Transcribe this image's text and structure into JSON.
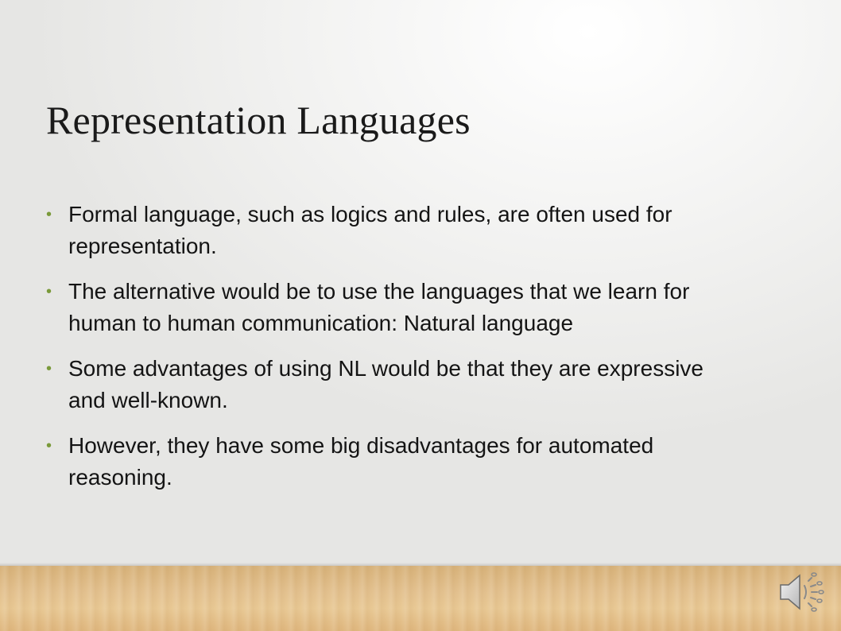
{
  "slide": {
    "title": "Representation Languages",
    "bullets": [
      "Formal language,  such as logics and rules, are  often used for representation.",
      "The alternative would be to use the languages that we learn for human to human communication: Natural language",
      "Some advantages of using NL would be that they are expressive and well-known.",
      "However, they have some big disadvantages for automated reasoning."
    ],
    "bullet_marker": "•"
  },
  "colors": {
    "bullet_accent": "#7a9a3a",
    "text": "#141414"
  },
  "icons": {
    "audio": "speaker-icon"
  }
}
